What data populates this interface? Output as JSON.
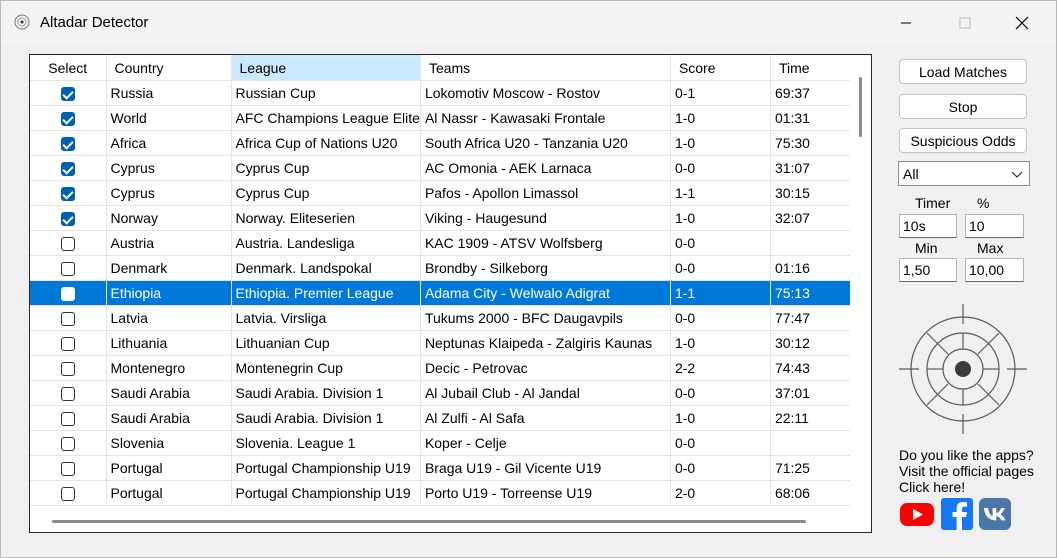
{
  "window": {
    "title": "Altadar Detector"
  },
  "columns": [
    "Select",
    "Country",
    "League",
    "Teams",
    "Score",
    "Time"
  ],
  "rows": [
    {
      "checked": true,
      "country": "Russia",
      "league": "Russian Cup",
      "teams": "Lokomotiv Moscow - Rostov",
      "score": "0-1",
      "time": "69:37"
    },
    {
      "checked": true,
      "country": "World",
      "league": "AFC Champions League Elite",
      "teams": "Al Nassr - Kawasaki Frontale",
      "score": "1-0",
      "time": "01:31"
    },
    {
      "checked": true,
      "country": "Africa",
      "league": "Africa Cup of Nations U20",
      "teams": "South Africa U20 - Tanzania U20",
      "score": "1-0",
      "time": "75:30"
    },
    {
      "checked": true,
      "country": "Cyprus",
      "league": "Cyprus Cup",
      "teams": "AC Omonia - AEK Larnaca",
      "score": "0-0",
      "time": "31:07"
    },
    {
      "checked": true,
      "country": "Cyprus",
      "league": "Cyprus Cup",
      "teams": "Pafos - Apollon Limassol",
      "score": "1-1",
      "time": "30:15"
    },
    {
      "checked": true,
      "country": "Norway",
      "league": "Norway. Eliteserien",
      "teams": "Viking - Haugesund",
      "score": "1-0",
      "time": "32:07"
    },
    {
      "checked": false,
      "country": "Austria",
      "league": "Austria. Landesliga",
      "teams": "KAC 1909 - ATSV Wolfsberg",
      "score": "0-0",
      "time": ""
    },
    {
      "checked": false,
      "country": "Denmark",
      "league": "Denmark. Landspokal",
      "teams": "Brondby - Silkeborg",
      "score": "0-0",
      "time": "01:16"
    },
    {
      "checked": false,
      "country": "Ethiopia",
      "league": "Ethiopia. Premier League",
      "teams": "Adama City - Welwalo Adigrat",
      "score": "1-1",
      "time": "75:13",
      "selected": true
    },
    {
      "checked": false,
      "country": "Latvia",
      "league": "Latvia. Virsliga",
      "teams": "Tukums 2000 - BFC Daugavpils",
      "score": "0-0",
      "time": "77:47"
    },
    {
      "checked": false,
      "country": "Lithuania",
      "league": "Lithuanian Cup",
      "teams": "Neptunas Klaipeda - Zalgiris Kaunas",
      "score": "1-0",
      "time": "30:12"
    },
    {
      "checked": false,
      "country": "Montenegro",
      "league": "Montenegrin Cup",
      "teams": "Decic - Petrovac",
      "score": "2-2",
      "time": "74:43"
    },
    {
      "checked": false,
      "country": "Saudi Arabia",
      "league": "Saudi Arabia. Division 1",
      "teams": "Al Jubail Club - Al Jandal",
      "score": "0-0",
      "time": "37:01"
    },
    {
      "checked": false,
      "country": "Saudi Arabia",
      "league": "Saudi Arabia. Division 1",
      "teams": "Al Zulfi - Al Safa",
      "score": "1-0",
      "time": "22:11"
    },
    {
      "checked": false,
      "country": "Slovenia",
      "league": "Slovenia. League 1",
      "teams": "Koper - Celje",
      "score": "0-0",
      "time": ""
    },
    {
      "checked": false,
      "country": "Portugal",
      "league": "Portugal Championship U19",
      "teams": "Braga U19 - Gil Vicente U19",
      "score": "0-0",
      "time": "71:25"
    },
    {
      "checked": false,
      "country": "Portugal",
      "league": "Portugal Championship U19",
      "teams": "Porto U19 - Torreense U19",
      "score": "2-0",
      "time": "68:06"
    }
  ],
  "panel": {
    "load_label": "Load Matches",
    "stop_label": "Stop",
    "odds_label": "Suspicious Odds",
    "filter_value": "All",
    "timer_label": "Timer",
    "percent_label": "%",
    "timer_value": "10s",
    "percent_value": "10",
    "min_label": "Min",
    "max_label": "Max",
    "min_value": "1,50",
    "max_value": "10,00",
    "promo_line1": "Do you like the apps?",
    "promo_line2": "Visit the official pages",
    "promo_line3": "Click here!"
  },
  "icons": [
    "app-radar-icon",
    "minimize-icon",
    "maximize-icon",
    "close-icon",
    "chevron-down-icon",
    "youtube-icon",
    "facebook-icon",
    "vk-icon"
  ],
  "colors": {
    "selection": "#0078d7",
    "checkbox": "#005fb8",
    "header_active": "#cce8ff",
    "youtube": "#ff0000",
    "facebook": "#1877f2",
    "vk": "#4a76a8"
  }
}
